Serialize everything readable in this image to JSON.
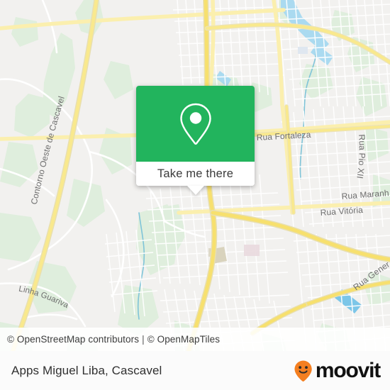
{
  "map": {
    "city": "Cascavel",
    "attribution": {
      "osm": "© OpenStreetMap contributors",
      "separator": "|",
      "tiles": "© OpenMapTiles"
    },
    "colors": {
      "land": "#f2f1ef",
      "park": "#dff0dc",
      "water": "#aadaf0",
      "highway": "#f7e06e",
      "arterial": "#fbeca0",
      "street": "#ffffff",
      "building": "#e8e6e2",
      "accent_green": "#22b45d",
      "brand_orange": "#f47f20"
    },
    "labels": [
      {
        "id": "contorno-oeste",
        "text": "Contorno Oeste de Cascavel"
      },
      {
        "id": "linha-guariva",
        "text": "Linha Guariva"
      },
      {
        "id": "rua-fortaleza",
        "text": "Rua Fortaleza"
      },
      {
        "id": "rua-pio-xii",
        "text": "Rua Pio XII"
      },
      {
        "id": "rua-maranhao",
        "text": "Rua Maranhão"
      },
      {
        "id": "rua-vitoria",
        "text": "Rua Vitória"
      },
      {
        "id": "rua-general",
        "text": "Rua General"
      }
    ]
  },
  "popup": {
    "icon": "map-pin-icon",
    "action_label": "Take me there"
  },
  "footer": {
    "title": "Apps Miguel Liba, Cascavel",
    "brand": {
      "icon": "moovit-pin-icon",
      "wordmark": "moovit"
    }
  }
}
